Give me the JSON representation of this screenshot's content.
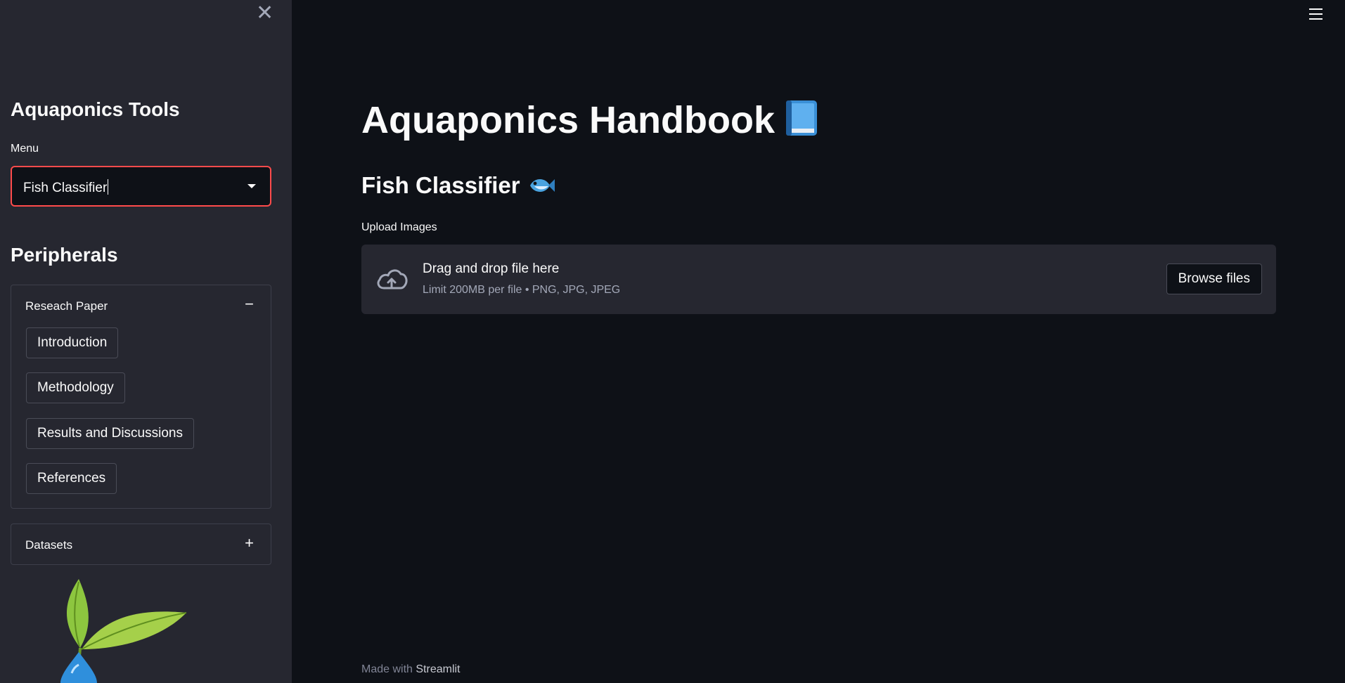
{
  "sidebar": {
    "close_icon": "close-icon",
    "title": "Aquaponics Tools",
    "menu_label": "Menu",
    "menu_selected": "Fish Classifier",
    "peripherals_title": "Peripherals",
    "research": {
      "label": "Reseach Paper",
      "toggle": "−",
      "buttons": [
        "Introduction",
        "Methodology",
        "Results and Discussions",
        "References"
      ]
    },
    "datasets": {
      "label": "Datasets",
      "toggle": "+"
    },
    "logo_icon": "leaf-water-logo"
  },
  "main": {
    "title": "Aquaponics Handbook",
    "title_icon": "book-icon",
    "section_title": "Fish Classifier",
    "section_icon": "fish-icon",
    "upload_label": "Upload Images",
    "dropzone": {
      "icon": "cloud-upload-icon",
      "text": "Drag and drop file here",
      "limit": "Limit 200MB per file • PNG, JPG, JPEG",
      "browse_label": "Browse files"
    }
  },
  "footer": {
    "prefix": "Made with",
    "link": "Streamlit"
  },
  "colors": {
    "background": "#0e1117",
    "sidebar": "#262730",
    "accent": "#ff4b4b"
  }
}
